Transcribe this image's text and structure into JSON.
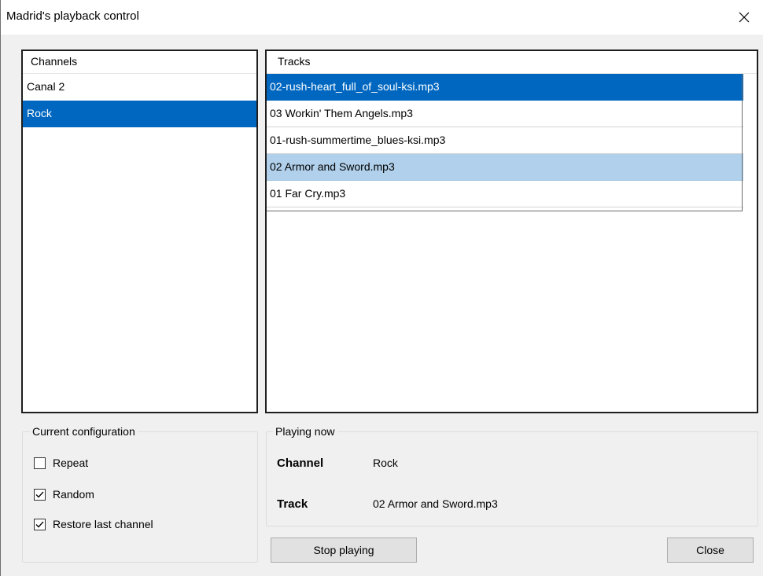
{
  "window": {
    "title": "Madrid's playback control"
  },
  "channels": {
    "header": "Channels",
    "items": [
      {
        "label": "Canal 2",
        "state": "normal"
      },
      {
        "label": "Rock",
        "state": "selected"
      }
    ]
  },
  "tracks": {
    "header": "Tracks",
    "items": [
      {
        "label": "02-rush-heart_full_of_soul-ksi.mp3",
        "state": "selected"
      },
      {
        "label": "03 Workin' Them Angels.mp3",
        "state": "normal"
      },
      {
        "label": "01-rush-summertime_blues-ksi.mp3",
        "state": "normal"
      },
      {
        "label": "02 Armor and Sword.mp3",
        "state": "highlight"
      },
      {
        "label": "01 Far Cry.mp3",
        "state": "normal"
      }
    ]
  },
  "configuration": {
    "title": "Current configuration",
    "options": [
      {
        "label": "Repeat",
        "checked": false
      },
      {
        "label": "Random",
        "checked": true
      },
      {
        "label": "Restore last channel",
        "checked": true
      }
    ]
  },
  "playing_now": {
    "title": "Playing now",
    "channel_label": "Channel",
    "channel_value": "Rock",
    "track_label": "Track",
    "track_value": "02 Armor and Sword.mp3"
  },
  "buttons": {
    "stop_label": "Stop playing",
    "close_label": "Close"
  },
  "colors": {
    "selection": "#0067c0",
    "highlight": "#b0d0eb"
  },
  "icons": {
    "close": "close-icon",
    "check": "checkmark-icon"
  }
}
